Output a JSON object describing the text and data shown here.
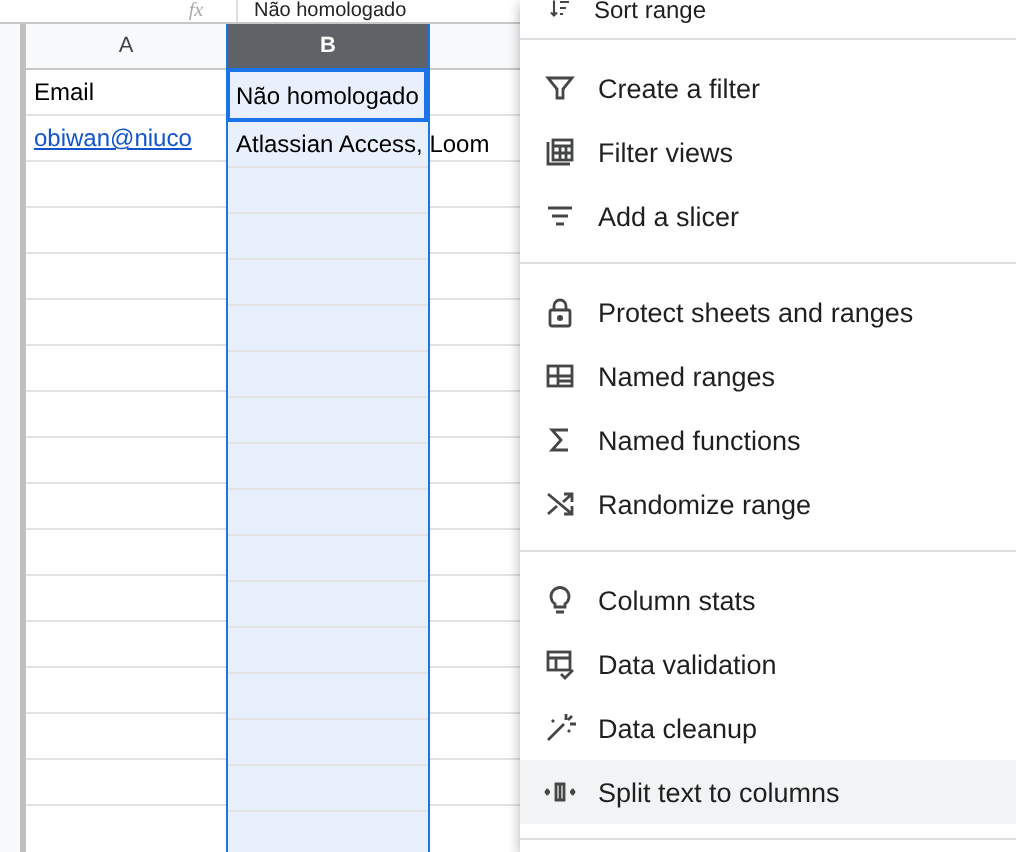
{
  "formula_bar": {
    "fx_label": "fx",
    "value": "Não homologado"
  },
  "sheet": {
    "columns": [
      {
        "label": "A",
        "selected": false
      },
      {
        "label": "B",
        "selected": true
      }
    ],
    "rows": [
      {
        "cells": [
          {
            "text": "Email",
            "link": false
          },
          {
            "text": "Não homologado",
            "link": false
          }
        ]
      },
      {
        "cells": [
          {
            "text": "obiwan@niuco",
            "link": true
          },
          {
            "text": "Atlassian Access, Loom",
            "link": false
          }
        ]
      }
    ]
  },
  "menu": {
    "groups": [
      {
        "items": [
          {
            "label": "Sort range",
            "hovered": false
          }
        ]
      },
      {
        "items": [
          {
            "label": "Create a filter",
            "hovered": false
          },
          {
            "label": "Filter views",
            "hovered": false
          },
          {
            "label": "Add a slicer",
            "hovered": false
          }
        ]
      },
      {
        "items": [
          {
            "label": "Protect sheets and ranges",
            "hovered": false
          },
          {
            "label": "Named ranges",
            "hovered": false
          },
          {
            "label": "Named functions",
            "hovered": false
          },
          {
            "label": "Randomize range",
            "hovered": false
          }
        ]
      },
      {
        "items": [
          {
            "label": "Column stats",
            "hovered": false
          },
          {
            "label": "Data validation",
            "hovered": false
          },
          {
            "label": "Data cleanup",
            "hovered": false
          },
          {
            "label": "Split text to columns",
            "hovered": true
          }
        ]
      }
    ]
  }
}
